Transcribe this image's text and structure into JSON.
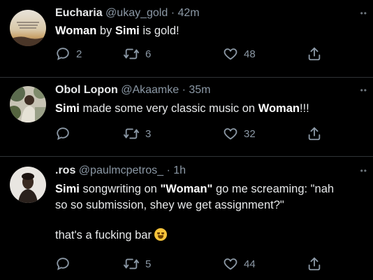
{
  "tweets": [
    {
      "name": "Eucharia",
      "handle": "@ukay_gold",
      "sep": "·",
      "time": "42m",
      "text": [
        {
          "t": "Woman",
          "b": true
        },
        {
          "t": " by ",
          "b": false
        },
        {
          "t": "Simi",
          "b": true
        },
        {
          "t": " is gold!",
          "b": false
        }
      ],
      "replies": "2",
      "retweets": "6",
      "likes": "48"
    },
    {
      "name": "Obol Lopon",
      "handle": "@Akaamke",
      "sep": "·",
      "time": "35m",
      "text": [
        {
          "t": "Simi",
          "b": true
        },
        {
          "t": " made some very classic music on ",
          "b": false
        },
        {
          "t": "Woman",
          "b": true
        },
        {
          "t": "!!!",
          "b": false
        }
      ],
      "replies": "",
      "retweets": "3",
      "likes": "32"
    },
    {
      "name": ".ros",
      "handle": "@paulmcpetros_",
      "sep": "·",
      "time": "1h",
      "text_line1": [
        {
          "t": "Simi",
          "b": true
        },
        {
          "t": " songwriting on ",
          "b": false
        },
        {
          "t": "\"Woman\"",
          "b": true
        },
        {
          "t": " go me screaming: \"nah",
          "b": false
        }
      ],
      "text_line2": "so so submission, shey we get assignment?\"",
      "text_line3": "that's a fucking bar",
      "emoji": "crying-laughing-face",
      "replies": "",
      "retweets": "5",
      "likes": "44"
    }
  ],
  "colors": {
    "background": "#000000",
    "divider": "#2f3336",
    "name": "#e7e9ea",
    "secondary": "#8b98a5"
  }
}
